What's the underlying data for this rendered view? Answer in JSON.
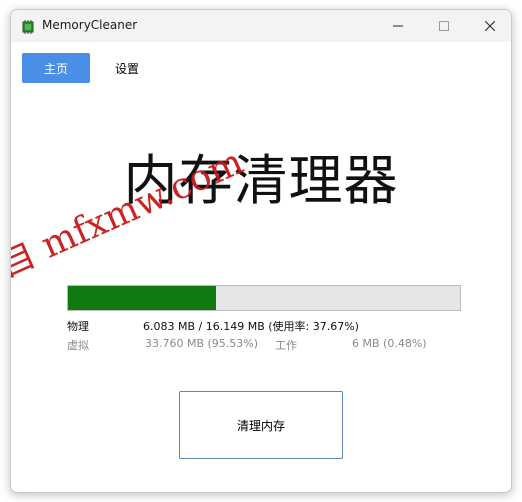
{
  "window": {
    "title": "MemoryCleaner",
    "controls": {
      "minimize_icon": "minimize-icon",
      "maximize_icon": "maximize-icon",
      "close_icon": "close-icon"
    }
  },
  "nav": {
    "home_label": "主页",
    "settings_label": "设置"
  },
  "main": {
    "heading": "内存清理器",
    "watermark": "自 mfxmw.com",
    "memory": {
      "usage_fraction": 0.3767,
      "physical_label": "物理",
      "physical_value": "6.083 MB / 16.149 MB (使用率: 37.67%)",
      "virtual_label": "虚拟",
      "virtual_value": "33.760 MB (95.53%)",
      "working_label": "工作",
      "working_value": "6 MB (0.48%)"
    },
    "clean_button_label": "清理内存"
  },
  "colors": {
    "accent": "#4a8ee7",
    "progress_fill": "#0f7a10",
    "progress_track": "#e6e6e6",
    "watermark": "#c81818"
  }
}
